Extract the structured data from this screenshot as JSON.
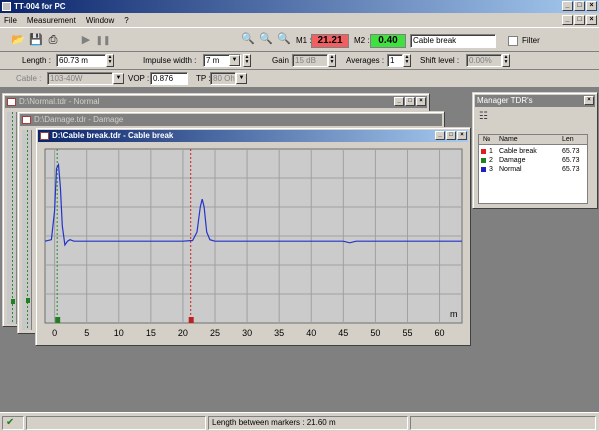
{
  "app": {
    "title": "TT-004 for PC"
  },
  "menu": [
    "File",
    "Measurement",
    "Window",
    "?"
  ],
  "toolbar": {
    "m1_label": "M1 :",
    "m1_value": "21.21",
    "m2_label": "M2 :",
    "m2_value": "0.40",
    "trace_name": "Cable break",
    "filter_label": "Filter"
  },
  "params": {
    "length_label": "Length :",
    "length_value": "60.73 m",
    "impulse_label": "Impulse width :",
    "impulse_value": "7 m",
    "gain_label": "Gain :",
    "gain_value": "15 dB",
    "averages_label": "Averages :",
    "averages_value": "1",
    "shift_label": "Shift level :",
    "shift_value": "0.00%",
    "cable_label": "Cable :",
    "cable_value": "103-40W",
    "vop_label": "VOP :",
    "vop_value": "0.876",
    "tp_label": "TP :",
    "tp_value": "80 Ohm"
  },
  "windows": {
    "normal_title": "D:\\Normal.tdr - Normal",
    "damage_title": "D:\\Damage.tdr - Damage",
    "cable_title": "D:\\Cable break.tdr - Cable break"
  },
  "manager": {
    "title": "Manager TDR's",
    "col_no": "№",
    "col_name": "Name",
    "col_len": "Len",
    "rows": [
      {
        "no": "1",
        "name": "Cable break",
        "len": "65.73",
        "color": "#e02020"
      },
      {
        "no": "2",
        "name": "Damage",
        "len": "65.73",
        "color": "#208020"
      },
      {
        "no": "3",
        "name": "Normal",
        "len": "65.73",
        "color": "#2020c0"
      }
    ]
  },
  "chart_data": {
    "type": "line",
    "xlabel": "m",
    "xlim": [
      -1.5,
      63.5
    ],
    "xticks": [
      0,
      5,
      10,
      15,
      20,
      25,
      30,
      35,
      40,
      45,
      50,
      55,
      60
    ],
    "tick_labels": [
      "0",
      "5",
      "10",
      "15",
      "20",
      "25",
      "30",
      "35",
      "40",
      "45",
      "50",
      "55",
      "60"
    ],
    "marker_m1": 21.21,
    "marker_m2": 0.4,
    "series": [
      {
        "color": "#2233cc",
        "x": [
          -1.5,
          -0.5,
          0.0,
          0.3,
          0.6,
          0.9,
          1.2,
          1.6,
          2.0,
          2.4,
          3.0,
          4.0,
          10.0,
          15.0,
          20.0,
          21.5,
          22.2,
          22.7,
          23.0,
          23.3,
          23.7,
          24.2,
          25.0,
          28.0,
          35.0,
          40.0,
          45.0,
          46.0,
          47.0,
          50.0,
          55.0,
          60.0,
          63.5
        ],
        "y": [
          0.0,
          0.02,
          0.4,
          0.95,
          1.0,
          0.7,
          0.2,
          -0.05,
          0.0,
          0.02,
          0.0,
          0.0,
          0.0,
          0.0,
          0.0,
          0.01,
          0.12,
          0.45,
          0.55,
          0.45,
          0.12,
          0.02,
          0.0,
          0.0,
          0.0,
          0.0,
          0.0,
          -0.02,
          0.0,
          0.0,
          0.0,
          0.0,
          0.0
        ]
      }
    ]
  },
  "status": {
    "length_between": "Length between markers : 21.60 m"
  }
}
